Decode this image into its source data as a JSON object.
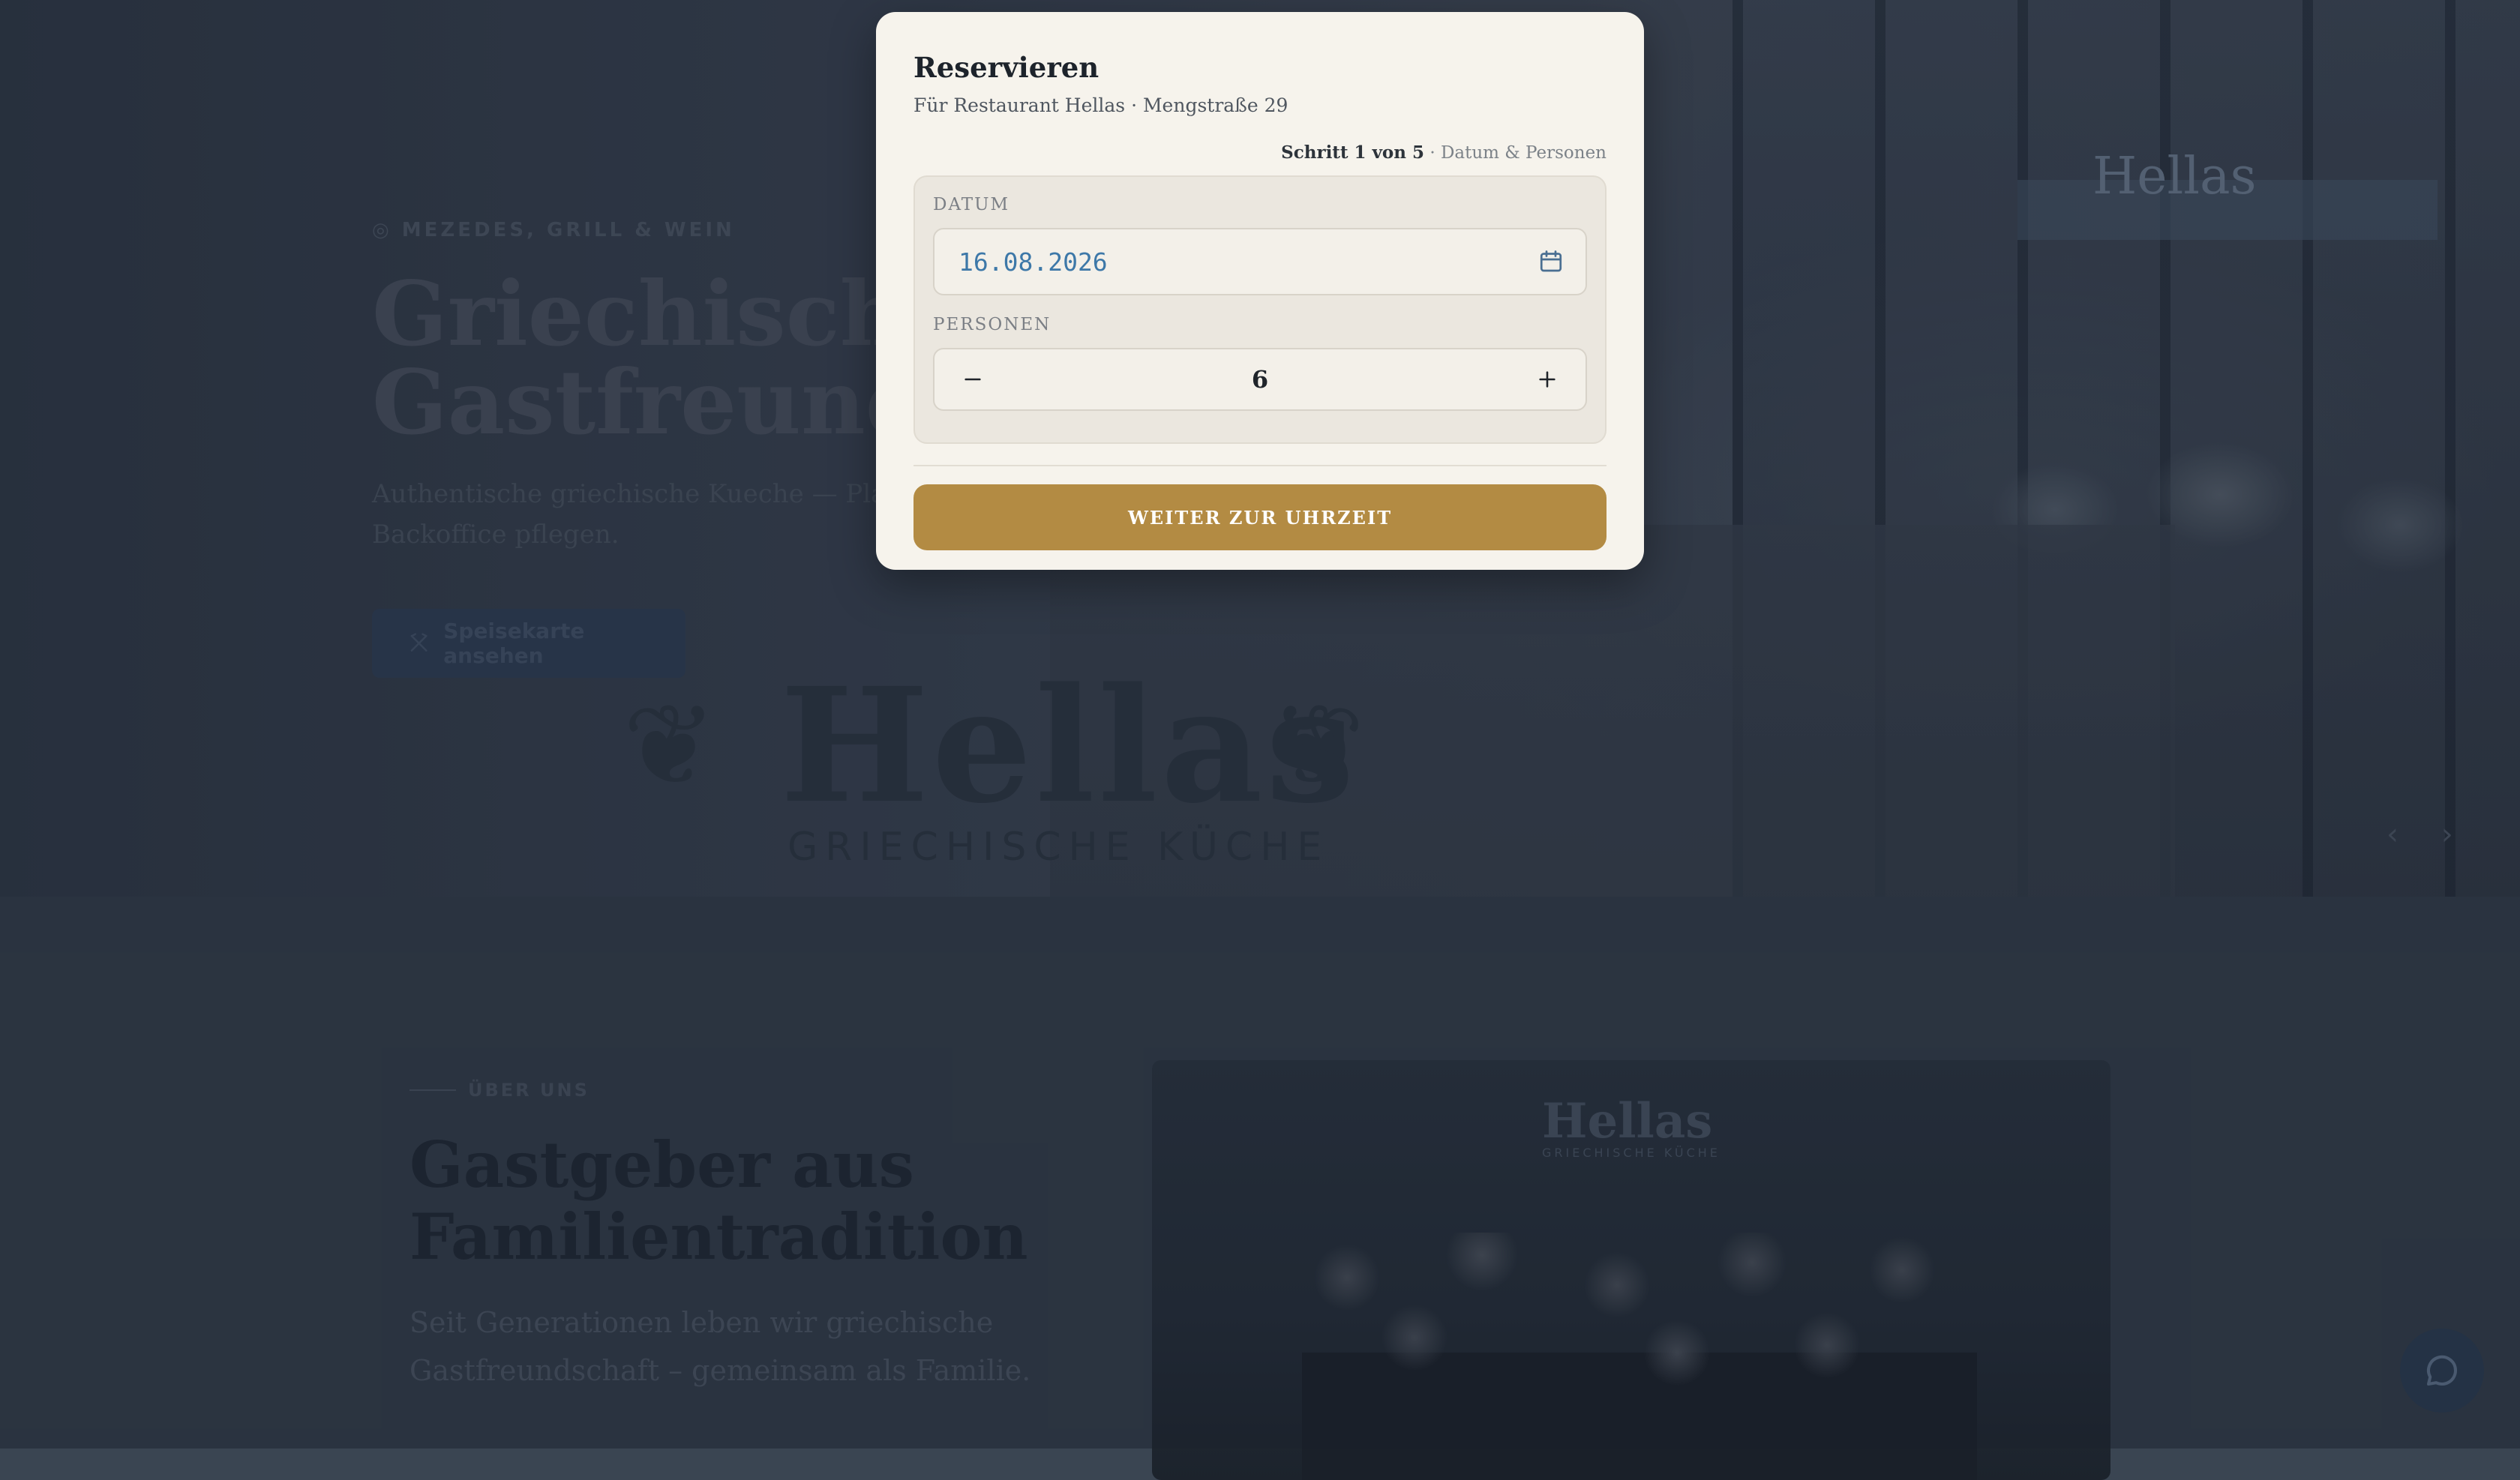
{
  "hero": {
    "eyebrow": "◎ MEZEDES, GRILL & WEIN",
    "title_line1": "Griechische",
    "title_line2": "Gastfreundschaft",
    "subtitle_line1": "Authentische griechische Kueche — Platzhalter",
    "subtitle_line2": "Backoffice pflegen.",
    "menu_button": "Speisekarte ansehen",
    "logo_word": "Hellas",
    "logo_sub": "GRIECHISCHE KÜCHE",
    "sign_text": "Hellas"
  },
  "about": {
    "eyebrow": "ÜBER UNS",
    "title_line1": "Gastgeber aus",
    "title_line2": "Familientradition",
    "subtitle_line1": "Seit Generationen leben wir griechische",
    "subtitle_line2": "Gastfreundschaft – gemeinsam als Familie.",
    "photo_sign": "Hellas",
    "photo_sign_sub": "GRIECHISCHE KÜCHE"
  },
  "modal": {
    "title": "Reservieren",
    "subtitle": "Für Restaurant Hellas · Mengstraße 29",
    "step_strong": "Schritt 1 von 5",
    "step_rest": " · Datum & Personen",
    "date_label": "DATUM",
    "date_value": "16.08.2026",
    "persons_label": "PERSONEN",
    "persons_value": "6",
    "minus": "−",
    "plus": "+",
    "submit": "WEITER ZUR UHRZEIT"
  },
  "icons": {
    "calendar": "calendar-icon",
    "chat": "chat-bubble-icon",
    "menu": "utensils-icon"
  },
  "colors": {
    "accent": "#b38b43",
    "date_text": "#3d78a8",
    "modal_bg": "#f6f3ec"
  }
}
